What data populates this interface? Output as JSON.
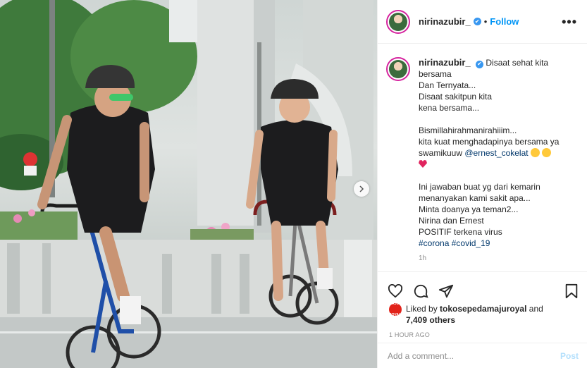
{
  "post": {
    "username": "nirinazubir_",
    "verified_mark": "✔",
    "dot": "•",
    "follow_label": "Follow",
    "more_label": "•••"
  },
  "caption": {
    "username": "nirinazubir_",
    "lines": [
      "Disaat sehat kita",
      "bersama",
      "Dan Ternyata...",
      "Disaat sakitpun kita",
      "kena bersama...",
      "",
      "Bismillahirahmanirahiiim...",
      "kita kuat menghadapinya bersama ya",
      "swamikuuw",
      "",
      "",
      "Ini jawaban buat yg dari kemarin",
      "menanyakan kami sakit apa...",
      "Minta doanya ya teman2...",
      "Nirina dan Ernest",
      "POSITIF terkena virus"
    ],
    "mention": "@ernest_cokelat",
    "hashtags": [
      "#corona",
      "#covid_19"
    ],
    "time": "1h"
  },
  "actions": {
    "like_icon": "heart-outline-icon",
    "comment_icon": "comment-bubble-icon",
    "share_icon": "paper-plane-icon",
    "save_icon": "bookmark-icon"
  },
  "likes": {
    "prefix": "Liked by",
    "user": "tokosepedamajuroyal",
    "and": "and",
    "others": "7,409 others",
    "avatar_text": "MAJU ROYAL"
  },
  "timestamp": "1 HOUR AGO",
  "comment": {
    "placeholder": "Add a comment...",
    "post_label": "Post"
  },
  "colors": {
    "accent": "#0095f6",
    "verified": "#3897f0",
    "heart": "#e0245e"
  }
}
